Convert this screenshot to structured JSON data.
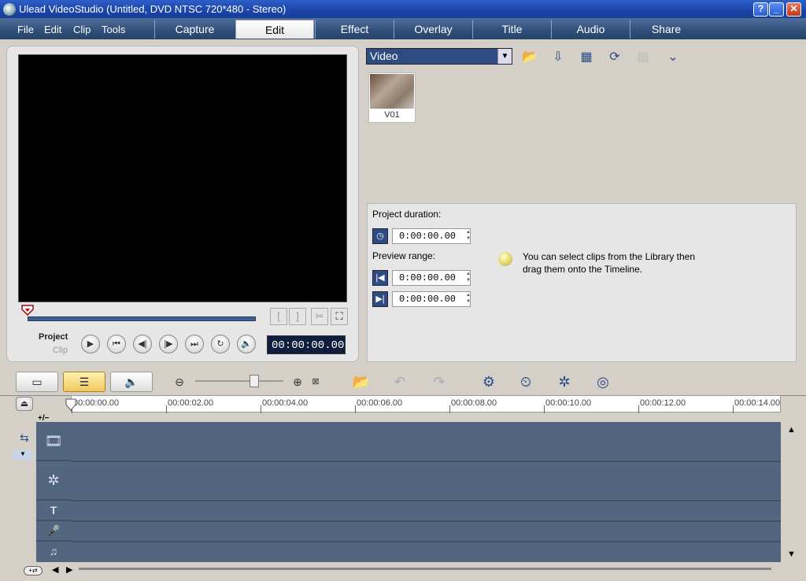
{
  "window": {
    "title": "Ulead VideoStudio (Untitled, DVD NTSC 720*480 - Stereo)",
    "buttons": {
      "help": "?",
      "minimize": "_",
      "maximize": "□",
      "close": "✕"
    }
  },
  "menu": {
    "items": [
      "File",
      "Edit",
      "Clip",
      "Tools"
    ]
  },
  "tabs": [
    "Capture",
    "Edit",
    "Effect",
    "Overlay",
    "Title",
    "Audio",
    "Share"
  ],
  "active_tab": "Edit",
  "preview": {
    "mode_project": "Project",
    "mode_clip": "Clip",
    "timecode": "00:00:00.00",
    "mark_in": "[",
    "mark_out": "]"
  },
  "library": {
    "category": "Video",
    "thumbnails": [
      {
        "label": "V01"
      }
    ]
  },
  "options": {
    "project_duration_label": "Project duration:",
    "project_duration": "0:00:00.00",
    "preview_range_label": "Preview range:",
    "range_start": "0:00:00.00",
    "range_end": "0:00:00.00",
    "tip": "You can select clips from the Library then drag them onto the Timeline."
  },
  "timeline": {
    "ruler": [
      "00:00:00.00",
      "00:00:02.00",
      "00:00:04.00",
      "00:00:06.00",
      "00:00:08.00",
      "00:00:10.00",
      "00:00:12.00",
      "00:00:14.00"
    ],
    "add_remove": "+/−"
  },
  "colors": {
    "accent": "#2f4c82",
    "track_bg": "#53667f",
    "active_view": "#f0c860"
  }
}
